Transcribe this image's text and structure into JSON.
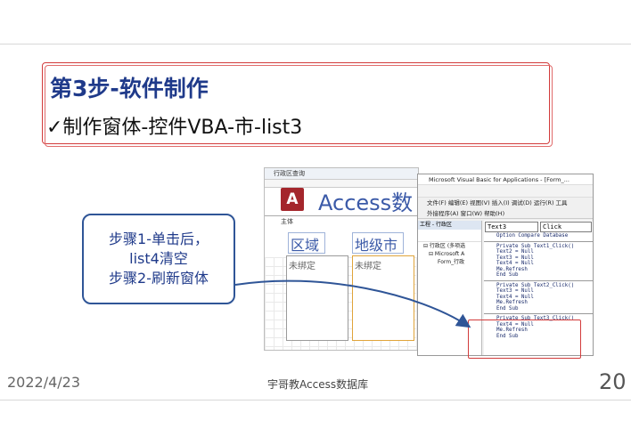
{
  "slide": {
    "title": "第3步-软件制作",
    "subtitle": "✓制作窗体-控件VBA-市-list3",
    "callout": {
      "line1": "步骤1-单击后，",
      "line2": "list4清空",
      "line3": "步骤2-刷新窗体"
    },
    "footer": {
      "date": "2022/4/23",
      "center": "宇哥教Access数据库",
      "page": "20"
    }
  },
  "access_form": {
    "tab_label": "行政区查询",
    "section_label": "主体",
    "logo_letter": "A",
    "app_title": "Access数",
    "header1": "区域",
    "header2": "地级市",
    "list1_text": "未绑定",
    "list2_text": "未绑定"
  },
  "vba_window": {
    "title": "Microsoft Visual Basic for Applications - [Form_...",
    "menu_row1": "文件(F)  编辑(E)  视图(V)  插入(I)  调试(D)  运行(R)  工具",
    "menu_row2": "外接程序(A)  窗口(W)  帮助(H)",
    "project_title": "工程 - 行政区",
    "tree": [
      "⊟ 行政区 (多项选",
      "⊟ Microsoft A",
      "Form_行政"
    ],
    "object_combo": "Text3",
    "proc_combo": "Click",
    "code_blocks": [
      [
        "Option Compare Database"
      ],
      [
        "Private Sub Text1_Click()",
        "Text2 = Null",
        "Text3 = Null",
        "Text4 = Null",
        "Me.Refresh",
        "End Sub"
      ],
      [
        "Private Sub Text2_Click()",
        "Text3 = Null",
        "Text4 = Null",
        "Me.Refresh",
        "End Sub"
      ],
      [
        "Private Sub Text3_Click()",
        "Text4 = Null",
        "Me.Refresh",
        "End Sub"
      ]
    ]
  },
  "colors": {
    "title": "#1f3a8a",
    "highlight": "#d23b3b",
    "callout_border": "#2f5597",
    "arrow": "#2f5597"
  }
}
